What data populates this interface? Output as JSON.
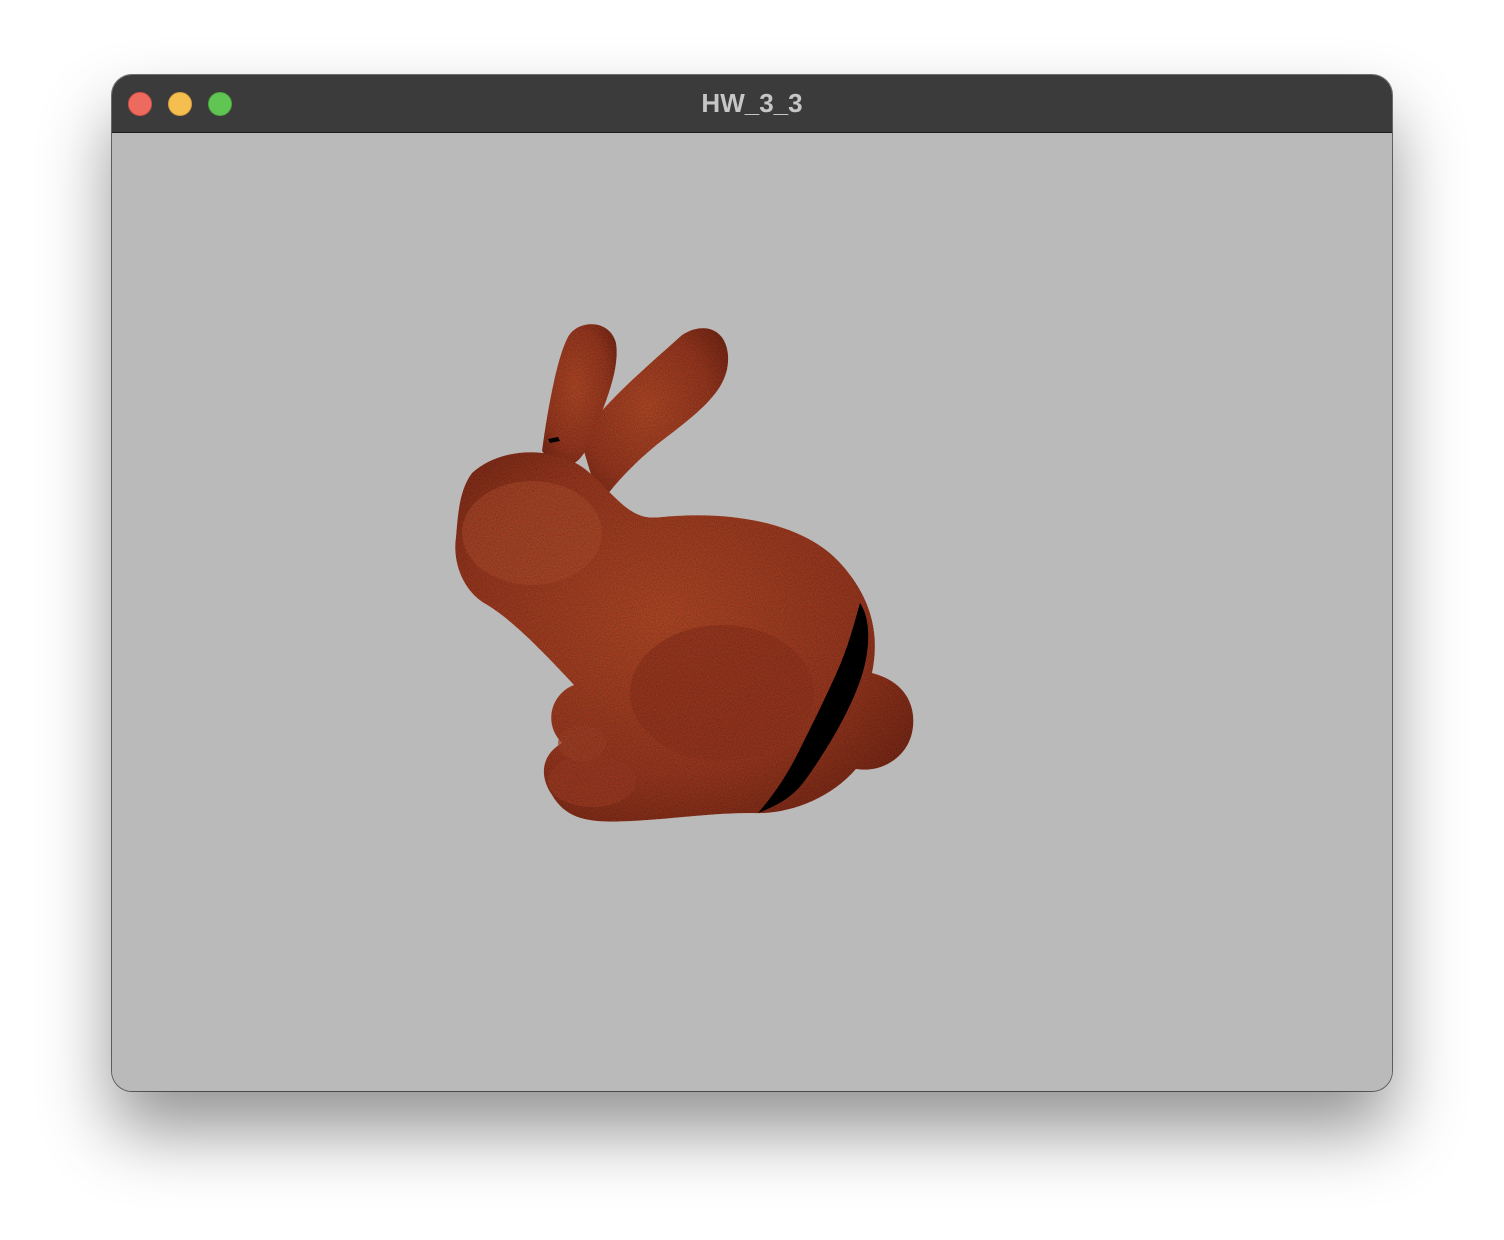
{
  "window": {
    "title": "HW_3_3"
  },
  "colors": {
    "titlebar": "#3b3b3b",
    "title_text": "#c6c6c6",
    "viewport_background": "#bababa",
    "close": "#ed6a5e",
    "minimize": "#f5bf4f",
    "maximize": "#61c554",
    "model_base": "#a8523a"
  },
  "viewport": {
    "content": "textured-bunny-model"
  }
}
